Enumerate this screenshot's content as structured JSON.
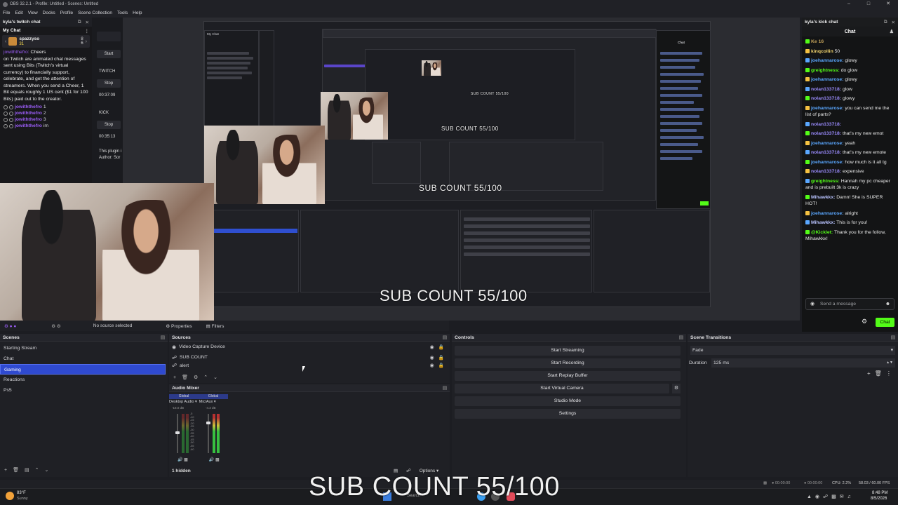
{
  "window": {
    "title": "OBS 32.2.1 - Profile: Untitled - Scenes: Untitled",
    "menu": [
      "File",
      "Edit",
      "View",
      "Docks",
      "Profile",
      "Scene Collection",
      "Tools",
      "Help"
    ]
  },
  "twitch_dock": {
    "title": "kyla's twitch chat",
    "my_chat": "My Chat",
    "top_user": "spazzyso",
    "top_count_a": "31",
    "top_count_b": "8",
    "top_count_c": "6",
    "message": "on Twitch are animated chat messages sent using Bits (Twitch's virtual currency) to financially support, celebrate, and get the attention of streamers. When you send a Cheer, 1 Bit equals roughly 1 US cent ($1 for 100 Bits) paid out to the creator.",
    "cheers": [
      {
        "user": "jowiththefro",
        "value": "1"
      },
      {
        "user": "jowiththefro",
        "value": "2"
      },
      {
        "user": "jowiththefro",
        "value": "3"
      },
      {
        "user": "jowiththefro",
        "value": "im"
      }
    ],
    "cut_label": "Cheers"
  },
  "midcol": {
    "start": "Start",
    "twitch": "TWITCH",
    "stop1": "Stop",
    "time1": "00:37:09",
    "kick": "KICK",
    "stop2": "Stop",
    "time2": "00:35:13",
    "plugin": "This plugin i",
    "author": "Author: Sor"
  },
  "overlay": {
    "sub_count": "SUB COUNT 55/100"
  },
  "propbar": {
    "no_source": "No source selected",
    "properties": "Properties",
    "filters": "Filters"
  },
  "scenes": {
    "title": "Scenes",
    "items": [
      "Starting Stream",
      "Chat",
      "Gaming",
      "Reactions",
      "Ps5"
    ],
    "selected": "Gaming"
  },
  "sources": {
    "title": "Sources",
    "items": [
      "Video Capture Device",
      "SUB COUNT",
      "alert"
    ]
  },
  "audio_mixer": {
    "title": "Audio Mixer",
    "global_a": "Global",
    "global_b": "Global",
    "ch1": "Desktop Audio",
    "ch2": "Mic/Aux",
    "db1": "-18.0 dB",
    "db2": "-4.3 dB",
    "scale": [
      "-5",
      "-10",
      "-15",
      "-20",
      "-25",
      "-30",
      "-35",
      "-40",
      "-45",
      "-50",
      "-55",
      "-60"
    ],
    "ch1_volume": 0.55,
    "ch2_volume": 0.8,
    "hidden": "1 hidden",
    "options": "Options"
  },
  "controls": {
    "title": "Controls",
    "buttons": [
      "Start Streaming",
      "Start Recording",
      "Start Replay Buffer",
      "Start Virtual Camera",
      "Studio Mode",
      "Settings"
    ]
  },
  "transitions": {
    "title": "Scene Transitions",
    "selected": "Fade",
    "duration_label": "Duration",
    "duration_value": "125 ms"
  },
  "kick_dock": {
    "title": "kyla's kick chat",
    "tab": "Chat",
    "messages": [
      {
        "user": "Ke 16",
        "text": "",
        "color": "#c4a35a"
      },
      {
        "user": "kinqcollin",
        "text": "50",
        "color": "#f5d76e"
      },
      {
        "user": "joehannarose:",
        "text": "glowy",
        "color": "#5aa7ff"
      },
      {
        "user": "greightness:",
        "text": "do glow",
        "color": "#53fc18"
      },
      {
        "user": "joehannarose:",
        "text": "glowy",
        "color": "#5aa7ff"
      },
      {
        "user": "nolan133718:",
        "text": "glow",
        "color": "#9b8cff"
      },
      {
        "user": "nolan133718:",
        "text": "glowy",
        "color": "#9b8cff"
      },
      {
        "user": "joehannarose:",
        "text": "you can send me the list of parts?",
        "color": "#5aa7ff"
      },
      {
        "user": "nolan133718:",
        "text": "",
        "color": "#9b8cff"
      },
      {
        "user": "nolan133718:",
        "text": "that's my new emot",
        "color": "#9b8cff"
      },
      {
        "user": "joehannarose:",
        "text": "yeah",
        "color": "#5aa7ff"
      },
      {
        "user": "nolan133718:",
        "text": "that's my new emote",
        "color": "#9b8cff"
      },
      {
        "user": "joehannarose:",
        "text": "how much is it all tg",
        "color": "#5aa7ff"
      },
      {
        "user": "nolan133718:",
        "text": "expensive",
        "color": "#9b8cff"
      },
      {
        "user": "greightness:",
        "text": "Hannah my pc cheaper and is prebuilt 3k is crazy",
        "color": "#53fc18"
      },
      {
        "user": "Mihawkkx:",
        "text": "Damn! She is SUPER HOT!",
        "color": "#b9c3ff"
      },
      {
        "user": "joehannarose:",
        "text": "alright",
        "color": "#5aa7ff"
      },
      {
        "user": "Mihawkkx:",
        "text": "This is for you!",
        "color": "#b9c3ff"
      },
      {
        "user": "@Kicklet:",
        "text": "Thank you for the follow, Mihawkkx!",
        "color": "#53fc18"
      }
    ],
    "input_placeholder": "Send a message",
    "chat_button": "Chat"
  },
  "statusbar": {
    "time1": "00:00:00",
    "time2": "00:00:00",
    "cpu": "CPU: 2.2%",
    "fps": "58.03 / 60.00 FPS"
  },
  "taskbar": {
    "weather_temp": "83°F",
    "weather_desc": "Sunny",
    "search": "Search",
    "clock_time": "8:48 PM",
    "clock_date": "8/5/2026"
  },
  "colors": {
    "selection": "#2f4ad0",
    "kick_green": "#53fc18",
    "twitch_purple": "#9b5df7"
  }
}
